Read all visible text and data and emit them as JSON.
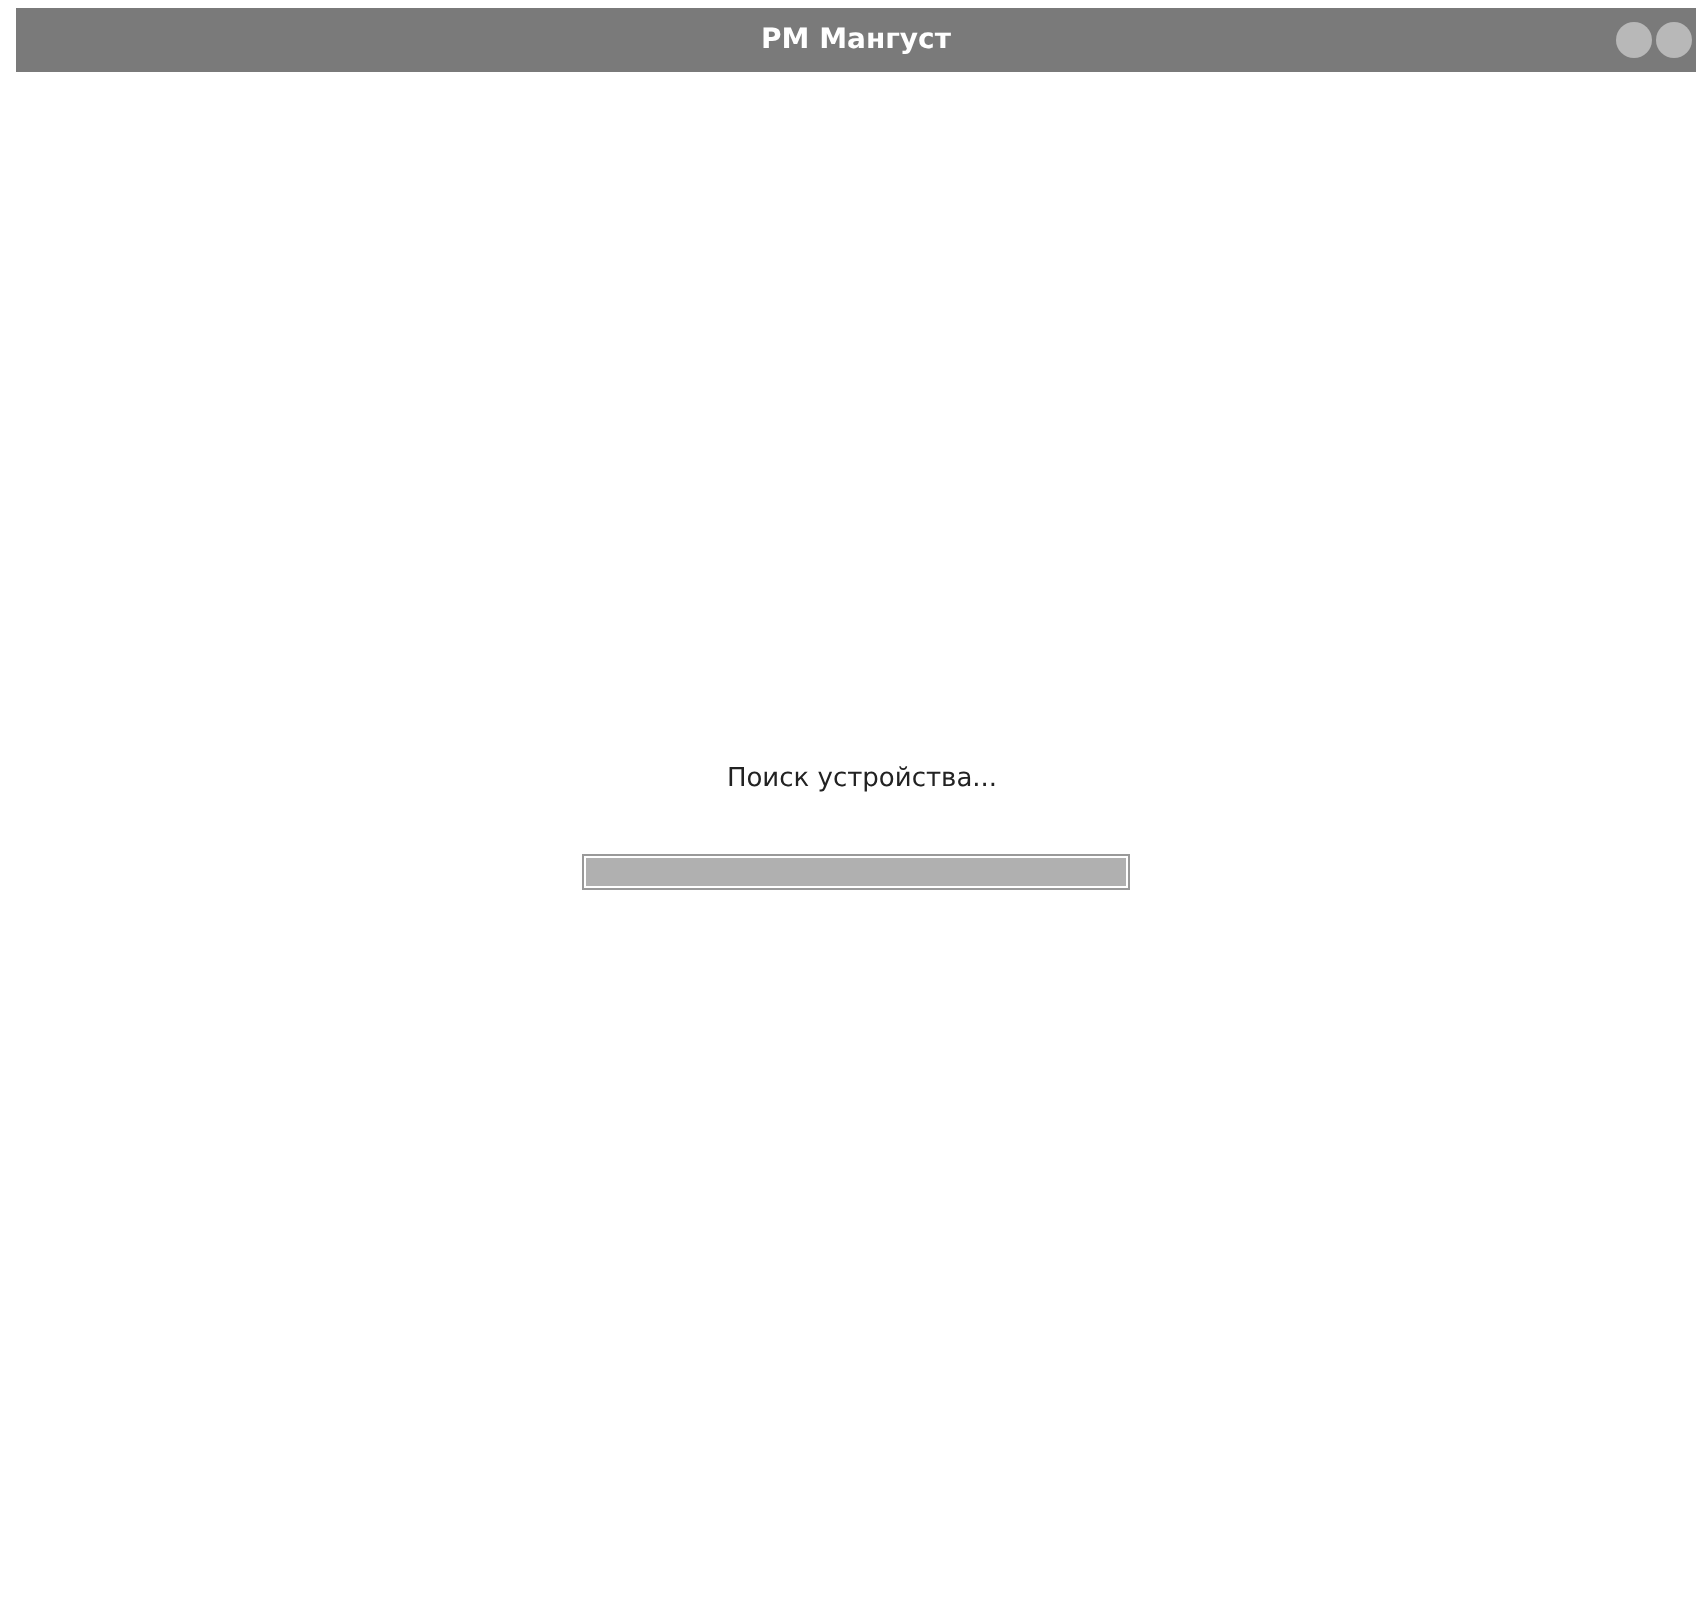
{
  "window": {
    "title": "PM Мангуст"
  },
  "status": {
    "message": "Поиск устройства...",
    "level": 1
  }
}
